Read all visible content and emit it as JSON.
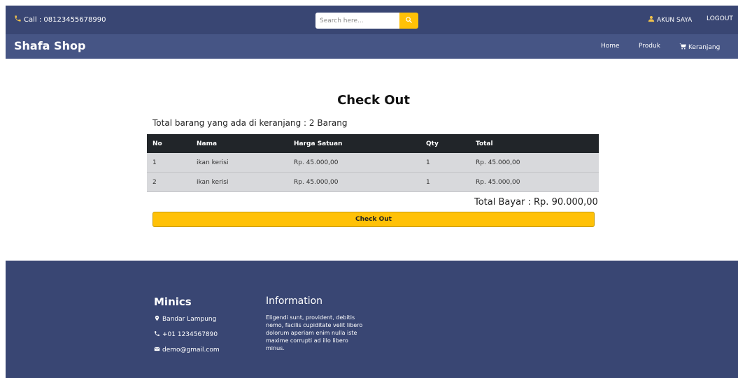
{
  "topbar": {
    "call": "Call : 08123455678990",
    "search_placeholder": "Search here...",
    "account": "AKUN SAYA",
    "logout": "LOGOUT"
  },
  "navbar": {
    "brand": "Shafa Shop",
    "home": "Home",
    "produk": "Produk",
    "cart": "Keranjang"
  },
  "main": {
    "title": "Check Out",
    "count_text": "Total barang yang ada di keranjang : 2 Barang",
    "table": {
      "headers": [
        "No",
        "Nama",
        "Harga Satuan",
        "Qty",
        "Total"
      ],
      "rows": [
        [
          "1",
          "ikan kerisi",
          "Rp. 45.000,00",
          "1",
          "Rp. 45.000,00"
        ],
        [
          "2",
          "ikan kerisi",
          "Rp. 45.000,00",
          "1",
          "Rp. 45.000,00"
        ]
      ]
    },
    "total_bayar": "Total Bayar : Rp. 90.000,00",
    "checkout_button": "Check Out"
  },
  "footer": {
    "brand": "Minics",
    "address": "Bandar Lampung",
    "phone": "+01 1234567890",
    "email": "demo@gmail.com",
    "info_title": "Information",
    "info_text": "Eligendi sunt, provident, debitis nemo, facilis cupiditate velit libero dolorum aperiam enim nulla iste maxime corrupti ad illo libero minus."
  },
  "colors": {
    "topbar": "#394673",
    "navbar": "#465585",
    "accent": "#ffc107",
    "table_header": "#212529",
    "table_row": "#d8d9dc"
  },
  "icons": [
    "phone-icon",
    "search-icon",
    "user-icon",
    "cart-icon",
    "map-marker-icon",
    "envelope-icon"
  ]
}
